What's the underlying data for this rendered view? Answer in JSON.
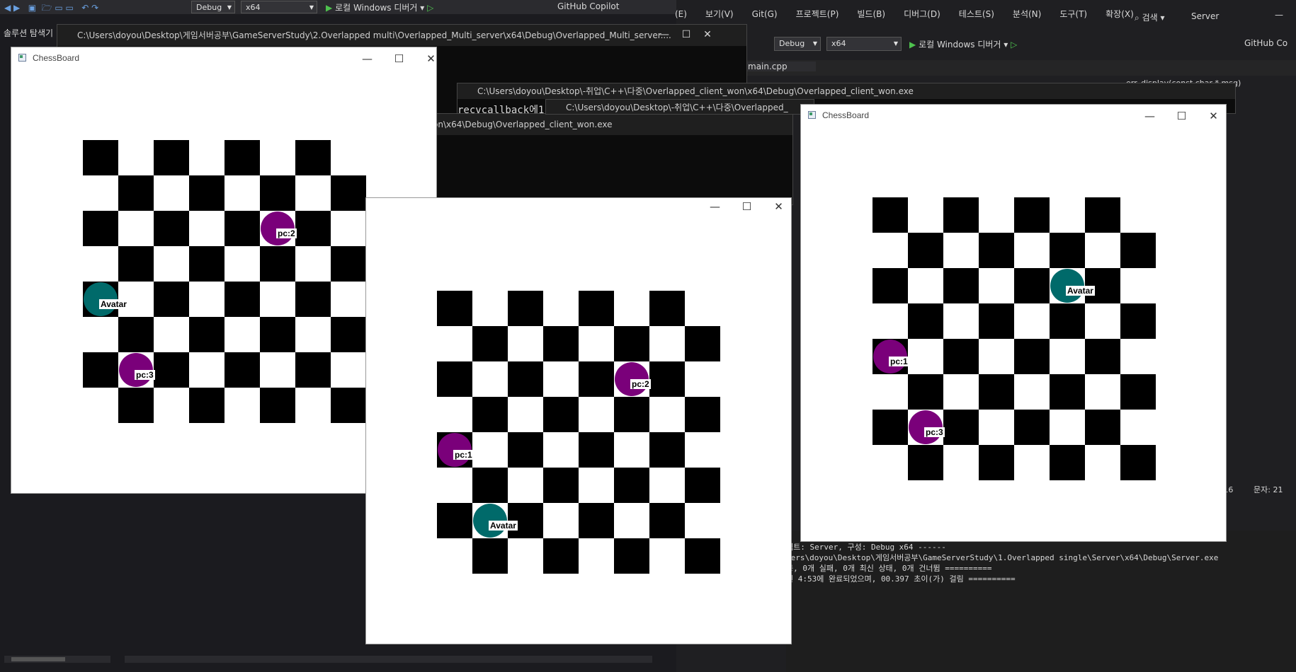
{
  "vs": {
    "toolbar_left": {
      "config": "Debug",
      "platform": "x64",
      "run": "로컬 Windows 디버거",
      "copilot": "GitHub Copilot"
    },
    "toolbar_right": {
      "config": "Debug",
      "platform": "x64",
      "run": "로컬 Windows 디버거",
      "copilot": "GitHub Co",
      "search": "검색",
      "solution": "Server"
    },
    "menu": [
      "(E)",
      "보기(V)",
      "Git(G)",
      "프로젝트(P)",
      "빌드(B)",
      "디버그(D)",
      "테스트(S)",
      "분석(N)",
      "도구(T)",
      "확장(X)"
    ],
    "solution_explorer_title": "솔루션 탐색기",
    "editor_tab": "main.cpp",
    "function_dropdown": "err_display(const char * msg)",
    "status": {
      "line": "줄: 16",
      "col": "문자: 21"
    },
    "output_lines": [
      "젝트: Server, 구성: Debug x64 ------",
      "sers\\doyou\\Desktop\\게임서버공부\\GameServerStudy\\1.Overlapped single\\Server\\x64\\Debug\\Server.exe",
      "공, 0개 실패, 0개 최신 상태, 0개 건너뜀 ==========",
      "전 4:53에 완료되었으며, 00.397 초이(가) 걸림 =========="
    ],
    "output_search": "검색"
  },
  "consoles": {
    "multi_server": "C:\\Users\\doyou\\Desktop\\게임서버공부\\GameServerStudy\\2.Overlapped multi\\Overlapped_Multi_server\\x64\\Debug\\Overlapped_Multi_server....",
    "client_top": "C:\\Users\\doyou\\Desktop\\-취업\\C++\\다중\\Overlapped_client_won\\x64\\Debug\\Overlapped_client_won.exe",
    "client_mid": "C:\\Users\\doyou\\Desktop\\-취업\\C++\\다중\\Overlapped_",
    "client_back": "on\\x64\\Debug\\Overlapped_client_won.exe",
    "recv_text": "recvcallback에1"
  },
  "windows": [
    {
      "title": "ChessBoard",
      "pieces": [
        {
          "label": "pc:2",
          "color": "#7a007a",
          "col": 5,
          "row": 2
        },
        {
          "label": "Avatar",
          "color": "#006a6a",
          "col": 0,
          "row": 4
        },
        {
          "label": "pc:3",
          "color": "#7a007a",
          "col": 1,
          "row": 6
        }
      ]
    },
    {
      "title": "",
      "pieces": [
        {
          "label": "pc:2",
          "color": "#7a007a",
          "col": 5,
          "row": 2
        },
        {
          "label": "pc:1",
          "color": "#7a007a",
          "col": 0,
          "row": 4
        },
        {
          "label": "Avatar",
          "color": "#006a6a",
          "col": 1,
          "row": 6
        }
      ]
    },
    {
      "title": "ChessBoard",
      "pieces": [
        {
          "label": "Avatar",
          "color": "#006a6a",
          "col": 5,
          "row": 2
        },
        {
          "label": "pc:1",
          "color": "#7a007a",
          "col": 0,
          "row": 4
        },
        {
          "label": "pc:3",
          "color": "#7a007a",
          "col": 1,
          "row": 6
        }
      ]
    }
  ],
  "caption_icons": [
    "minimize-icon",
    "maximize-icon",
    "close-icon"
  ]
}
